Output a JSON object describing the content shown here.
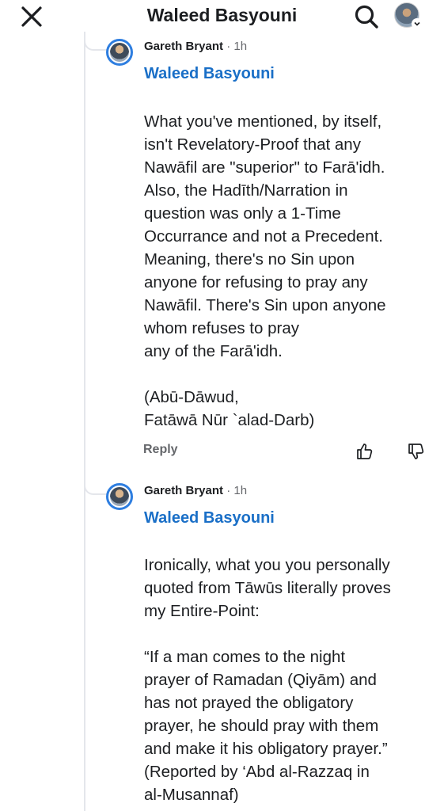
{
  "header": {
    "title": "Waleed Basyouni"
  },
  "comments": [
    {
      "author": "Gareth Bryant",
      "time": " · 1h",
      "mention": "Waleed Basyouni",
      "body": "What you've mentioned, by itself,\nisn't Revelatory-Proof that any\nNawāfil are \"superior\" to Farā'idh.\nAlso, the Hadīth/Narration in\nquestion was only a 1-Time\nOccurrance and not a Precedent.\nMeaning, there's no Sin upon\nanyone for refusing to pray any\nNawāfil. There's Sin upon anyone\nwhom refuses to pray\nany of the Farā'idh.\n\n(Abū-Dāwud,\nFatāwā Nūr `alad-Darb)",
      "reply_label": "Reply"
    },
    {
      "author": "Gareth Bryant",
      "time": " · 1h",
      "mention": "Waleed Basyouni",
      "body": "Ironically, what you you personally\nquoted from Tāwūs literally proves\nmy Entire-Point:\n\n“If a man comes to the night\nprayer of Ramadan (Qiyām) and\nhas not prayed the obligatory\nprayer, he should pray with them\nand make it his obligatory prayer.”\n(Reported by ‘Abd al-Razzaq in\nal-Musannaf)"
    }
  ]
}
